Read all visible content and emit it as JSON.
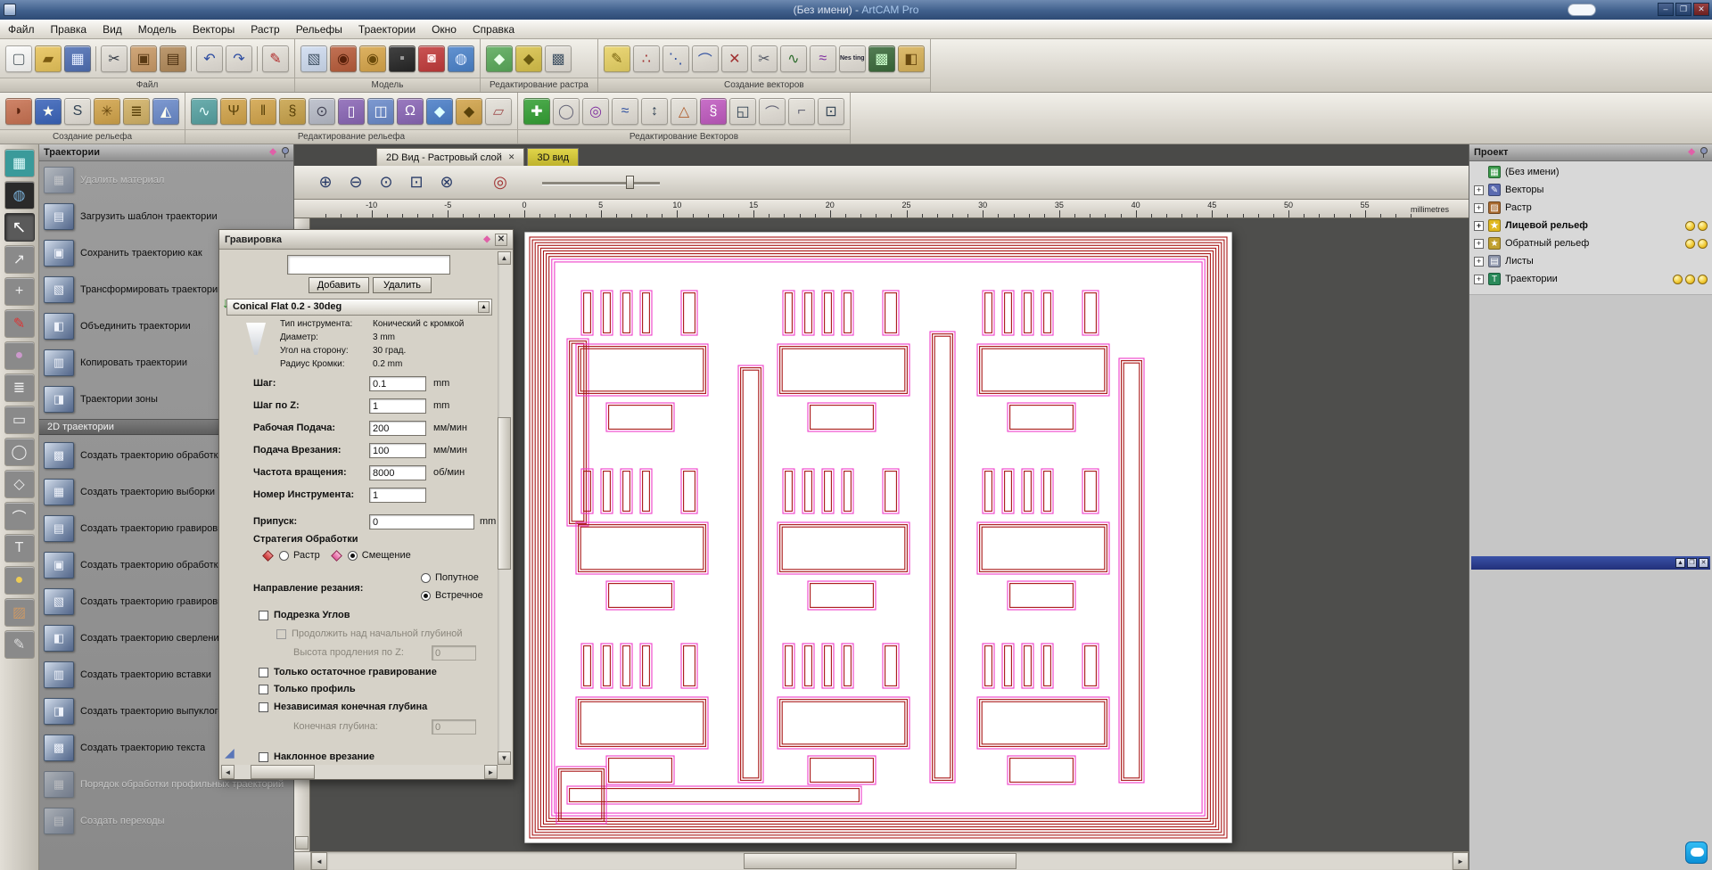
{
  "window": {
    "doc_part": "(Без имени) - ",
    "app_part": "ArtCAM Pro",
    "controls": {
      "minimize": "–",
      "maximize": "❐",
      "close": "✕"
    }
  },
  "menubar": {
    "items": [
      {
        "name": "menu-file",
        "label": "Файл"
      },
      {
        "name": "menu-edit",
        "label": "Правка"
      },
      {
        "name": "menu-view",
        "label": "Вид"
      },
      {
        "name": "menu-model",
        "label": "Модель"
      },
      {
        "name": "menu-vectors",
        "label": "Векторы"
      },
      {
        "name": "menu-bitmap",
        "label": "Растр"
      },
      {
        "name": "menu-reliefs",
        "label": "Рельефы"
      },
      {
        "name": "menu-toolpaths",
        "label": "Траектории"
      },
      {
        "name": "menu-window",
        "label": "Окно"
      },
      {
        "name": "menu-help",
        "label": "Справка"
      }
    ]
  },
  "toolbar_row1": [
    {
      "label": "Файл",
      "icons": [
        {
          "n": "new-model-icon",
          "g": "▢",
          "c": "#fcfcfa",
          "f": "#556066"
        },
        {
          "n": "open-model-icon",
          "g": "▰",
          "c": "#e8c45a",
          "f": "#7a5a10"
        },
        {
          "n": "save-model-icon",
          "g": "▦",
          "c": "#4f6fb4",
          "f": "#e6eeff"
        },
        {
          "n": "cut-icon",
          "g": "✂",
          "c": "#e4e0d8",
          "f": "#333a44",
          "sep": true
        },
        {
          "n": "copy-icon",
          "g": "▣",
          "c": "#c99a66",
          "f": "#5a3a14"
        },
        {
          "n": "paste-icon",
          "g": "▤",
          "c": "#b28a5a",
          "f": "#4a2e0e"
        },
        {
          "n": "undo-icon",
          "g": "↶",
          "c": "#e4e0d8",
          "f": "#2a4aa0",
          "sep": true
        },
        {
          "n": "redo-icon",
          "g": "↷",
          "c": "#e4e0d8",
          "f": "#2a4aa0"
        },
        {
          "n": "edit-vectors-icon",
          "g": "✎",
          "c": "#e4e0d8",
          "f": "#b02828",
          "sep": true
        }
      ]
    },
    {
      "label": "Модель",
      "icons": [
        {
          "n": "greyscale-view-icon",
          "g": "▧",
          "c": "#cfdcf0",
          "f": "#445566"
        },
        {
          "n": "relief-red-icon",
          "g": "◉",
          "c": "#b85c3a",
          "f": "#58200a"
        },
        {
          "n": "relief-gold-icon",
          "g": "◉",
          "c": "#d8a64a",
          "f": "#6a4a0a"
        },
        {
          "n": "shaded-preview-icon",
          "g": "▪",
          "c": "#262626",
          "f": "#999999"
        },
        {
          "n": "light-material-icon",
          "g": "◙",
          "c": "#c23a3a",
          "f": "#ffecec"
        },
        {
          "n": "texture-sphere-icon",
          "g": "◍",
          "c": "#4a82ca",
          "f": "#e0ecff"
        }
      ]
    },
    {
      "label": "Редактирование растра",
      "icons": [
        {
          "n": "edit-raster-icon",
          "g": "◆",
          "c": "#5aaa5a",
          "f": "#eaffea"
        },
        {
          "n": "paint-raster-icon",
          "g": "◆",
          "c": "#d8c24a",
          "f": "#6a5a10"
        },
        {
          "n": "link-colors-icon",
          "g": "▩",
          "c": "#e4e0d8",
          "f": "#445566"
        }
      ]
    },
    {
      "label": "Создание векторов",
      "icons": [
        {
          "n": "create-polyline-icon",
          "g": "✎",
          "c": "#e8d264",
          "f": "#7a6510"
        },
        {
          "n": "create-points-icon",
          "g": "∴",
          "c": "#e4e0d8",
          "f": "#a03030"
        },
        {
          "n": "node-editing-icon",
          "g": "⋱",
          "c": "#e4e0d8",
          "f": "#3050a0"
        },
        {
          "n": "create-arc-icon",
          "g": "⌒",
          "c": "#e4e0d8",
          "f": "#3050a0"
        },
        {
          "n": "trim-vector-icon",
          "g": "✕",
          "c": "#e4e0d8",
          "f": "#a03030"
        },
        {
          "n": "knife-icon",
          "g": "✂",
          "c": "#e4e0d8",
          "f": "#555a66"
        },
        {
          "n": "join-vectors-icon",
          "g": "∿",
          "c": "#e4e0d8",
          "f": "#2a6a2a"
        },
        {
          "n": "fit-curves-icon",
          "g": "≈",
          "c": "#e4e0d8",
          "f": "#8030a0"
        },
        {
          "n": "nesting-icon",
          "g": "Nes ting",
          "c": "#e4e0d8",
          "f": "#222233",
          "tiny": true
        },
        {
          "n": "bitmap-to-vector-icon",
          "g": "▩",
          "c": "#3a6a3a",
          "f": "#ccffcc"
        },
        {
          "n": "slice-icon",
          "g": "◧",
          "c": "#d8b258",
          "f": "#6a4a10"
        }
      ]
    }
  ],
  "toolbar_row2": [
    {
      "label": "Создание рельефа",
      "icons": [
        {
          "n": "shape-editor-icon",
          "g": "◗",
          "c": "#c87252",
          "f": "#5a2410"
        },
        {
          "n": "texture-relief-icon",
          "g": "★",
          "c": "#3a64ba",
          "f": "#fffff0"
        },
        {
          "n": "sculpting-icon",
          "g": "S",
          "c": "#e4e0d8",
          "f": "#334455"
        },
        {
          "n": "weave-wizard-icon",
          "g": "✳",
          "c": "#d2a44a",
          "f": "#6a4a10"
        },
        {
          "n": "stacked-relief-icon",
          "g": "≣",
          "c": "#d2b266",
          "f": "#5a420a"
        },
        {
          "n": "extrude-icon",
          "g": "◭",
          "c": "#6a8aca",
          "f": "#fffff0"
        }
      ]
    },
    {
      "label": "Редактирование рельефа",
      "icons": [
        {
          "n": "smooth-relief-icon",
          "g": "∿",
          "c": "#56a2a2",
          "f": "#e8ffff"
        },
        {
          "n": "sculpt-tool-icon",
          "g": "Ψ",
          "c": "#d2a44a",
          "f": "#5a420a"
        },
        {
          "n": "relief-columns-icon",
          "g": "‖",
          "c": "#d2a44a",
          "f": "#5a420a"
        },
        {
          "n": "spiral-relief-icon",
          "g": "§",
          "c": "#c8a24a",
          "f": "#5a420a"
        },
        {
          "n": "lock-relief-icon",
          "g": "⊙",
          "c": "#b8bcc8",
          "f": "#444455"
        },
        {
          "n": "pillar-icon",
          "g": "▯",
          "c": "#8a66b6",
          "f": "#ffffff"
        },
        {
          "n": "pillow-icon",
          "g": "◫",
          "c": "#6a8aca",
          "f": "#ffffff"
        },
        {
          "n": "twist-icon",
          "g": "Ω",
          "c": "#8a66b6",
          "f": "#ffffff"
        },
        {
          "n": "gem-icon",
          "g": "◆",
          "c": "#4a7ec8",
          "f": "#ddffff"
        },
        {
          "n": "dropper-icon",
          "g": "◆",
          "c": "#d2a44a",
          "f": "#5a420a"
        },
        {
          "n": "eraser-icon",
          "g": "▱",
          "c": "#e4e0d8",
          "f": "#a05050"
        }
      ]
    },
    {
      "label": "Редактирование Векторов",
      "icons": [
        {
          "n": "add-node-icon",
          "g": "✚",
          "c": "#34a034",
          "f": "#ffffff"
        },
        {
          "n": "ring-icon",
          "g": "◯",
          "c": "#e4e0d8",
          "f": "#666677"
        },
        {
          "n": "offset-vector-icon",
          "g": "◎",
          "c": "#e4e0d8",
          "f": "#8030a0"
        },
        {
          "n": "wave-vectors-icon",
          "g": "≈",
          "c": "#e4e0d8",
          "f": "#3050a0"
        },
        {
          "n": "measure-z-icon",
          "g": "↕",
          "c": "#e4e0d8",
          "f": "#334455"
        },
        {
          "n": "bell-icon",
          "g": "△",
          "c": "#e4e0d8",
          "f": "#b06030"
        },
        {
          "n": "spiral-vector-icon",
          "g": "§",
          "c": "#c05ac0",
          "f": "#ffffff"
        },
        {
          "n": "boolean-icon",
          "g": "◱",
          "c": "#e4e0d8",
          "f": "#334455"
        },
        {
          "n": "arc-fit-icon",
          "g": "⌒",
          "c": "#e4e0d8",
          "f": "#666677"
        },
        {
          "n": "trim-tool-icon",
          "g": "⌐",
          "c": "#e4e0d8",
          "f": "#666677"
        },
        {
          "n": "center-in-page-icon",
          "g": "⊡",
          "c": "#e4e0d8",
          "f": "#334455"
        }
      ]
    }
  ],
  "left_strip": [
    {
      "n": "model-chip-icon",
      "g": "▦",
      "c": "#3a9a9a",
      "f": "#e8ffff"
    },
    {
      "n": "world-icon",
      "g": "◍",
      "c": "#2a2a2a",
      "f": "#7ab0d8"
    },
    {
      "n": "select-cursor-icon",
      "g": "↖",
      "c": "#5a5a5a",
      "f": "#ffffff",
      "sel": true
    },
    {
      "n": "node-cursor-icon",
      "g": "↗",
      "c": "#8a8a8a",
      "f": "#eeeeee"
    },
    {
      "n": "transform-icon",
      "g": "+",
      "c": "#8a8a8a",
      "f": "#eeeeee"
    },
    {
      "n": "measure-pen-icon",
      "g": "✎",
      "c": "#8a8a8a",
      "f": "#dd3333"
    },
    {
      "n": "paint-ball-icon",
      "g": "●",
      "c": "#8a8a8a",
      "f": "#cc99cc"
    },
    {
      "n": "layers-icon",
      "g": "≣",
      "c": "#8a8a8a",
      "f": "#eeeeee"
    },
    {
      "n": "rectangle-tool-icon",
      "g": "▭",
      "c": "#8a8a8a",
      "f": "#eeeeee"
    },
    {
      "n": "ellipse-tool-icon",
      "g": "◯",
      "c": "#8a8a8a",
      "f": "#eeeeee"
    },
    {
      "n": "polygon-tool-icon",
      "g": "◇",
      "c": "#8a8a8a",
      "f": "#eeeeee"
    },
    {
      "n": "arc-tool-icon",
      "g": "⌒",
      "c": "#8a8a8a",
      "f": "#eeeeee"
    },
    {
      "n": "text-tool-icon",
      "g": "T",
      "c": "#8a8a8a",
      "f": "#eeeeee"
    },
    {
      "n": "droplet-tool-icon",
      "g": "●",
      "c": "#8a8a8a",
      "f": "#eecc55"
    },
    {
      "n": "texture-bag-icon",
      "g": "▨",
      "c": "#8a8a8a",
      "f": "#cc9966"
    },
    {
      "n": "carve-knife-icon",
      "g": "✎",
      "c": "#8a8a8a",
      "f": "#dddddd"
    }
  ],
  "toolpaths_panel": {
    "title": "Траектории",
    "section_2d": "2D траектории",
    "items_top": [
      {
        "label": "Удалить материал",
        "disabled": true
      },
      {
        "label": "Загрузить шаблон траектории"
      },
      {
        "label": "Сохранить траекторию как"
      },
      {
        "label": "Трансформировать траектории"
      },
      {
        "label": "Объединить траектории"
      },
      {
        "label": "Копировать траектории"
      },
      {
        "label": "Траектории зоны"
      }
    ],
    "items_2d": [
      {
        "label": "Создать траекторию обработки"
      },
      {
        "label": "Создать траекторию выборки"
      },
      {
        "label": "Создать траекторию гравировки"
      },
      {
        "label": "Создать траекторию обработки"
      },
      {
        "label": "Создать траекторию гравировки"
      },
      {
        "label": "Создать траекторию сверления"
      },
      {
        "label": "Создать траекторию вставки"
      },
      {
        "label": "Создать траекторию выпуклого"
      },
      {
        "label": "Создать траекторию текста"
      },
      {
        "label": "Порядок обработки профильных траекторий",
        "disabled": true
      },
      {
        "label": "Создать переходы",
        "disabled": true
      }
    ]
  },
  "view_tabs": [
    {
      "label": "2D Вид - Растровый слой",
      "active": true,
      "closable": true
    },
    {
      "label": "3D вид",
      "highlighted": true
    }
  ],
  "zoom_toolbar": {
    "buttons": [
      {
        "n": "zoom-in-icon",
        "g": "⊕"
      },
      {
        "n": "zoom-out-icon",
        "g": "⊖"
      },
      {
        "n": "zoom-objects-icon",
        "g": "⊙"
      },
      {
        "n": "zoom-box-icon",
        "g": "⊡"
      },
      {
        "n": "zoom-last-icon",
        "g": "⊗"
      },
      {
        "n": "snapshot-icon",
        "g": "◎",
        "gap": true
      }
    ],
    "slider_pos": 0.78
  },
  "ruler": {
    "unit": "millimetres",
    "major_ticks": [
      -10,
      -5,
      0,
      5,
      10,
      15,
      20,
      25,
      30,
      35,
      40,
      45,
      50,
      55
    ]
  },
  "engraving_dialog": {
    "title": "Гравировка",
    "add_button": "Добавить",
    "remove_button": "Удалить",
    "tool_header": "Conical Flat 0.2 - 30deg",
    "tool_info": [
      {
        "label": "Тип инструмента:",
        "value": "Конический с кромкой"
      },
      {
        "label": "Диаметр:",
        "value": "3 mm"
      },
      {
        "label": "Угол на сторону:",
        "value": "30 град."
      },
      {
        "label": "Радиус Кромки:",
        "value": "0.2 mm"
      }
    ],
    "params": [
      {
        "label": "Шаг:",
        "value": "0.1",
        "unit": "mm"
      },
      {
        "label": "Шаг по Z:",
        "value": "1",
        "unit": "mm"
      },
      {
        "label": "Рабочая Подача:",
        "value": "200",
        "unit": "мм/мин"
      },
      {
        "label": "Подача Врезания:",
        "value": "100",
        "unit": "мм/мин"
      },
      {
        "label": "Частота вращения:",
        "value": "8000",
        "unit": "об/мин"
      },
      {
        "label": "Номер Инструмента:",
        "value": "1",
        "unit": ""
      }
    ],
    "allowance": {
      "label": "Припуск:",
      "value": "0",
      "unit": "mm"
    },
    "strategy": {
      "label": "Стратегия Обработки",
      "options": [
        {
          "label": "Растр",
          "selected": false
        },
        {
          "label": "Смещение",
          "selected": true
        }
      ]
    },
    "direction": {
      "label": "Направление резания:",
      "options": [
        {
          "label": "Попутное",
          "selected": false
        },
        {
          "label": "Встречное",
          "selected": true
        }
      ]
    },
    "flags": [
      {
        "type": "check",
        "label": "Подрезка Углов"
      },
      {
        "type": "check",
        "label": "Продолжить над начальной глубиной",
        "disabled": true,
        "indent": true
      },
      {
        "type": "field",
        "label": "Высота продления по Z:",
        "value": "0",
        "disabled": true
      },
      {
        "type": "check",
        "label": "Только остаточное гравирование"
      },
      {
        "type": "check",
        "label": "Только профиль"
      },
      {
        "type": "check",
        "label": "Независимая конечная глубина"
      },
      {
        "type": "field",
        "label": "Конечная глубина:",
        "value": "0",
        "disabled": true
      },
      {
        "type": "check",
        "label": "Наклонное врезание",
        "icon": "ramp-icon"
      }
    ]
  },
  "project_panel": {
    "title": "Проект",
    "tree": [
      {
        "label": "(Без имени)",
        "icon": "model-root-icon"
      },
      {
        "label": "Векторы",
        "icon": "vectors-icon",
        "expandable": true
      },
      {
        "label": "Растр",
        "icon": "raster-icon",
        "expandable": true
      },
      {
        "label": "Лицевой рельеф",
        "icon": "front-relief-icon",
        "expandable": true,
        "bold": true,
        "bulbs": 2
      },
      {
        "label": "Обратный рельеф",
        "icon": "back-relief-icon",
        "expandable": true,
        "bulbs": 2
      },
      {
        "label": "Листы",
        "icon": "sheets-icon",
        "expandable": true
      },
      {
        "label": "Траектории",
        "icon": "toolpaths-icon",
        "expandable": true,
        "bulbs": 3
      }
    ]
  },
  "colors": {
    "toolpath_red": "#a81616",
    "toolpath_pink": "#ee3cc8",
    "model_bg": "#ffffff",
    "canvas_bg": "#4e4e4c",
    "highlight_tab": "#d8cc3e",
    "panel_blue_bar": "#2c3e96"
  }
}
